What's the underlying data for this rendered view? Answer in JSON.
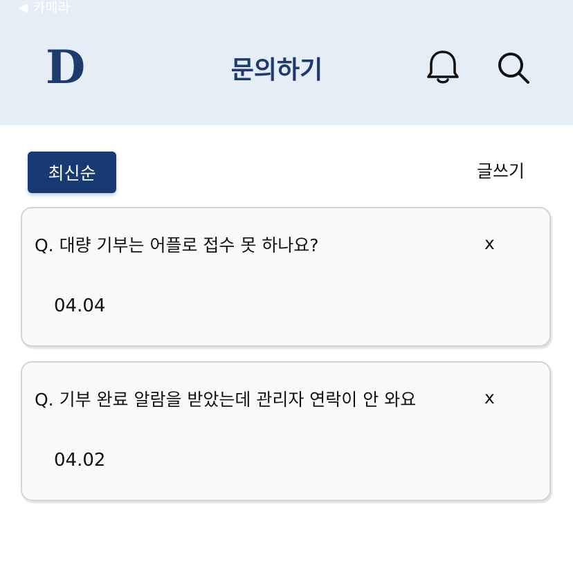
{
  "status_bar": {
    "back_label": "◀ 카메라"
  },
  "header": {
    "logo_text": "D",
    "title": "문의하기",
    "icons": [
      "bell-icon",
      "search-icon"
    ],
    "background": "#e5edf7",
    "title_color": "#1e3a6e"
  },
  "toolbar": {
    "sort_label": "최신순",
    "write_label": "글쓰기",
    "accent": "#183a72"
  },
  "inquiries": [
    {
      "question": "Q. 대량 기부는 어플로 접수 못 하나요?",
      "date": "04.04",
      "close": "x"
    },
    {
      "question": "Q. 기부 완료 알람을 받았는데 관리자 연락이 안 와요",
      "date": "04.02",
      "close": "x"
    }
  ]
}
